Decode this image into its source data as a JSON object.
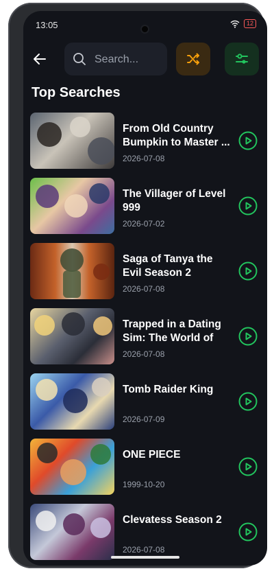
{
  "status_bar": {
    "time": "13:05",
    "battery": "12",
    "icons": [
      "wifi-icon",
      "battery-icon"
    ]
  },
  "topbar": {
    "back_icon": "arrow-left-icon",
    "search": {
      "placeholder": "Search...",
      "value": ""
    },
    "shuffle_icon": "shuffle-icon",
    "filter_icon": "sliders-icon"
  },
  "section_title": "Top Searches",
  "items": [
    {
      "title": "From Old Country Bumpkin to Master ...",
      "date": "2026-07-08"
    },
    {
      "title": "The Villager of Level 999",
      "date": "2026-07-02"
    },
    {
      "title": "Saga of Tanya the Evil Season 2",
      "date": "2026-07-08"
    },
    {
      "title": "Trapped in a Dating Sim: The World of O...",
      "date": "2026-07-08"
    },
    {
      "title": "Tomb Raider King",
      "date": "2026-07-09"
    },
    {
      "title": "ONE PIECE",
      "date": "1999-10-20"
    },
    {
      "title": "Clevatess Season 2",
      "date": "2026-07-08"
    }
  ],
  "colors": {
    "accent_green": "#22c55e",
    "accent_orange": "#f59e0b",
    "background": "#12141a",
    "card": "#1d2029"
  }
}
